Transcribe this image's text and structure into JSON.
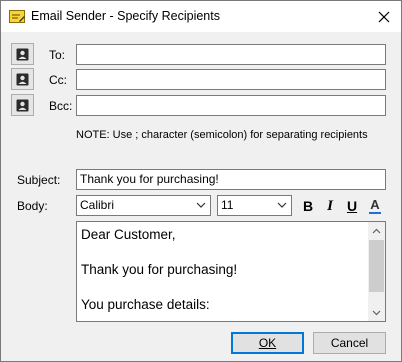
{
  "window": {
    "title": "Email Sender - Specify Recipients"
  },
  "recipients": {
    "to_label": "To:",
    "to_value": "",
    "cc_label": "Cc:",
    "cc_value": "",
    "bcc_label": "Bcc:",
    "bcc_value": "",
    "note": "NOTE: Use ; character (semicolon) for separating recipients"
  },
  "message": {
    "subject_label": "Subject:",
    "subject_value": "Thank you for purchasing!",
    "body_label": "Body:",
    "font_name": "Calibri",
    "font_size": "11",
    "body_text": "Dear Customer,\n\nThank you for purchasing!\n\nYou purchase details:"
  },
  "format": {
    "bold": "B",
    "italic": "I",
    "underline": "U",
    "color": "A",
    "color_accent": "#1e6fd9"
  },
  "buttons": {
    "ok": "OK",
    "cancel": "Cancel"
  },
  "icons": {
    "title": "email-edit-icon",
    "contact": "contact-card-icon",
    "close": "close-icon"
  }
}
